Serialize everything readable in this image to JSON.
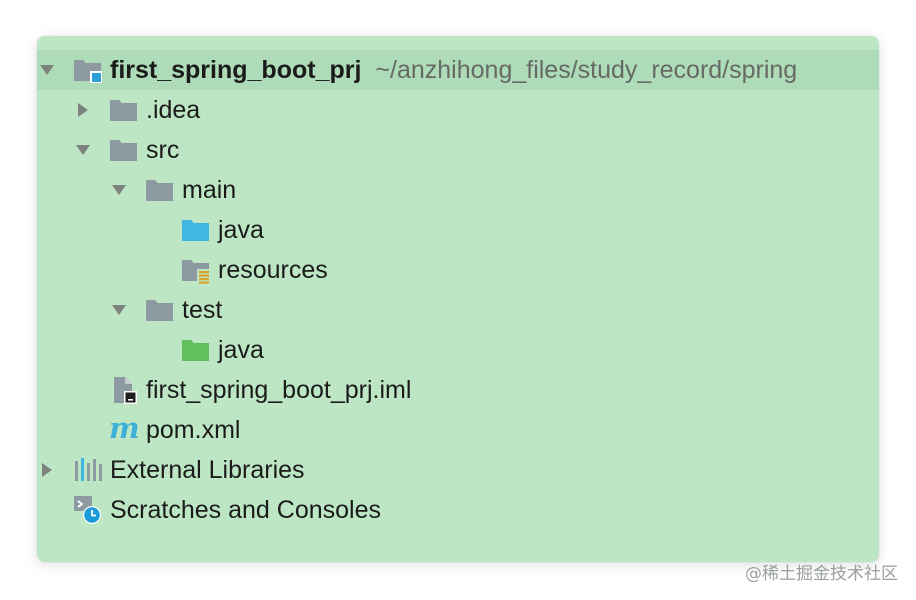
{
  "tree": {
    "root": {
      "name": "first_spring_boot_prj",
      "path": "~/anzhihong_files/study_record/spring"
    },
    "idea": ".idea",
    "src": "src",
    "main": "main",
    "main_java": "java",
    "resources": "resources",
    "test": "test",
    "test_java": "java",
    "iml_file": "first_spring_boot_prj.iml",
    "pom_file": "pom.xml",
    "maven_glyph": "m",
    "external_libraries": "External Libraries",
    "scratches": "Scratches and Consoles"
  },
  "watermark": "@稀土掘金技术社区",
  "colors": {
    "panel_bg": "#bde6c5",
    "folder_gray": "#8e9aa1",
    "source_folder_blue": "#40b6e0",
    "test_folder_green": "#5fc05c",
    "maven_blue": "#3eb0d6",
    "module_badge": "#2d9fd8"
  }
}
